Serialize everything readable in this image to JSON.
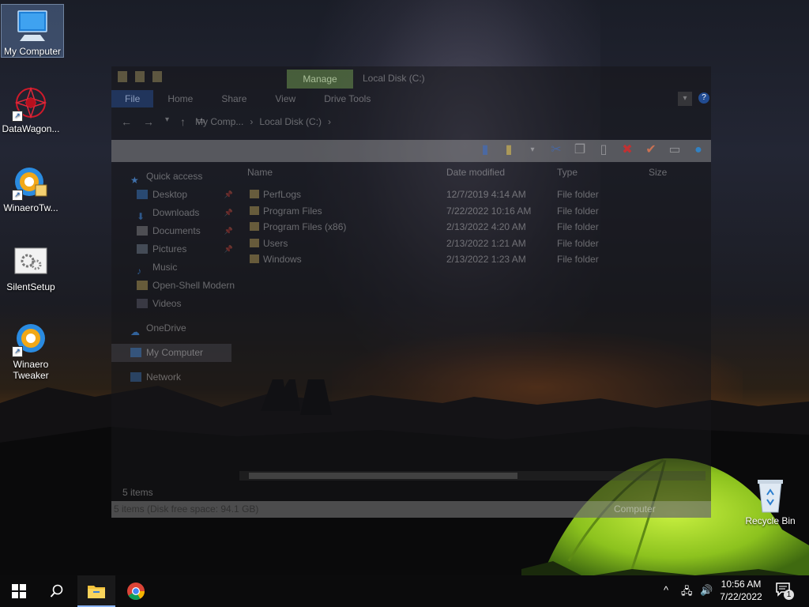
{
  "desktop": {
    "icons": [
      {
        "label": "My Computer"
      },
      {
        "label": "DataWagon..."
      },
      {
        "label": "WinaeroTw..."
      },
      {
        "label": "SilentSetup"
      },
      {
        "label": "Winaero Tweaker"
      },
      {
        "label": "Recycle Bin"
      }
    ]
  },
  "explorer": {
    "context_tab": "Manage",
    "title": "Local Disk (C:)",
    "ribbon_tabs": [
      "File",
      "Home",
      "Share",
      "View",
      "Drive Tools"
    ],
    "help_symbol": "?",
    "breadcrumb": [
      "My Comp...",
      "›",
      "Local Disk (C:)",
      "›"
    ],
    "navigation": [
      {
        "label": "Quick access",
        "level": "top",
        "icon": "star-icon"
      },
      {
        "label": "Desktop",
        "pinned": true,
        "icon": "desktop-folder-icon"
      },
      {
        "label": "Downloads",
        "pinned": true,
        "icon": "downloads-icon"
      },
      {
        "label": "Documents",
        "pinned": true,
        "icon": "documents-icon"
      },
      {
        "label": "Pictures",
        "pinned": true,
        "icon": "pictures-icon"
      },
      {
        "label": "Music",
        "icon": "music-icon"
      },
      {
        "label": "Open-Shell Modern",
        "icon": "folder-icon"
      },
      {
        "label": "Videos",
        "icon": "videos-icon"
      },
      {
        "label": "OneDrive",
        "level": "top",
        "icon": "cloud-icon"
      },
      {
        "label": "My Computer",
        "level": "top",
        "selected": true,
        "icon": "computer-icon"
      },
      {
        "label": "Network",
        "level": "top",
        "icon": "network-icon"
      }
    ],
    "columns": {
      "name": "Name",
      "date": "Date modified",
      "type": "Type",
      "size": "Size"
    },
    "files": [
      {
        "name": "PerfLogs",
        "date": "12/7/2019 4:14 AM",
        "type": "File folder"
      },
      {
        "name": "Program Files",
        "date": "7/22/2022 10:16 AM",
        "type": "File folder"
      },
      {
        "name": "Program Files (x86)",
        "date": "2/13/2022 4:20 AM",
        "type": "File folder"
      },
      {
        "name": "Users",
        "date": "2/13/2022 1:21 AM",
        "type": "File folder"
      },
      {
        "name": "Windows",
        "date": "2/13/2022 1:23 AM",
        "type": "File folder"
      }
    ],
    "status_items": "5 items",
    "status_bar_text": "5 items (Disk free space: 94.1 GB)",
    "status_zone": "Computer"
  },
  "taskbar": {
    "time": "10:56 AM",
    "date": "7/22/2022",
    "notification_count": "1"
  }
}
